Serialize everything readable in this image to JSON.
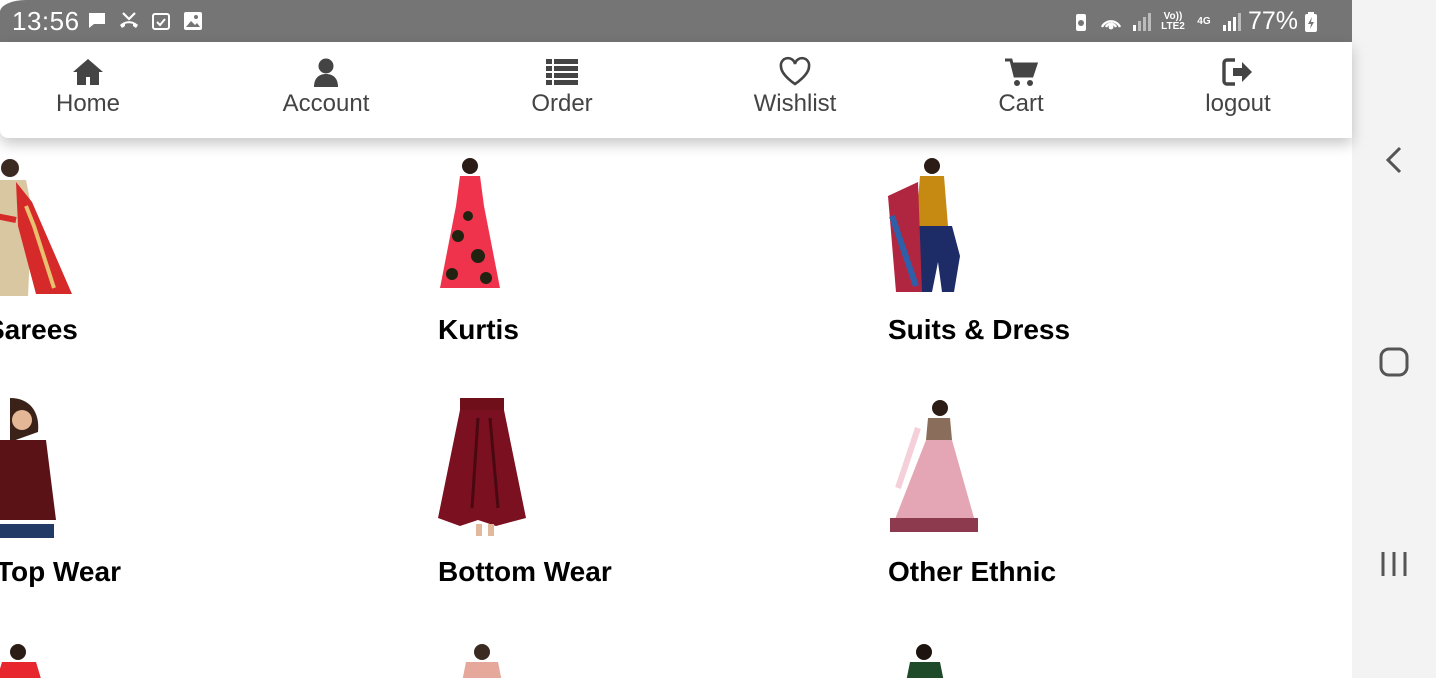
{
  "status_bar": {
    "time": "13:56",
    "left_icons": [
      "message-icon",
      "missed-call-icon",
      "calendar-check-icon",
      "image-icon"
    ],
    "volte_label": "Vo)) LTE2",
    "network_label": "4G",
    "battery_percent": "77%"
  },
  "nav": {
    "items": [
      {
        "label": "Home",
        "icon": "home-icon"
      },
      {
        "label": "Account",
        "icon": "user-icon"
      },
      {
        "label": "Order",
        "icon": "list-icon"
      },
      {
        "label": "Wishlist",
        "icon": "heart-icon"
      },
      {
        "label": "Cart",
        "icon": "cart-icon"
      },
      {
        "label": "logout",
        "icon": "logout-icon"
      }
    ]
  },
  "categories": [
    {
      "name": "Sarees"
    },
    {
      "name": "Kurtis"
    },
    {
      "name": "Suits & Dress"
    },
    {
      "name": "Top Wear"
    },
    {
      "name": "Bottom Wear"
    },
    {
      "name": "Other Ethnic"
    }
  ],
  "colors": {
    "status_bar": "#757575",
    "nav_icon": "#444444",
    "system_nav_bg": "#f3f3f3"
  }
}
